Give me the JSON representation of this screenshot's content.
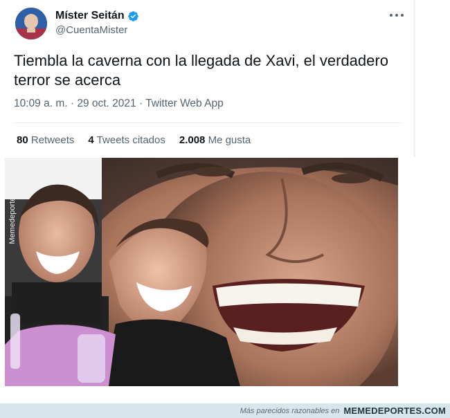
{
  "tweet": {
    "display_name": "Míster Seitán",
    "handle": "@CuentaMister",
    "text": "Tiembla la caverna con la llegada de Xavi, el verdadero terror se acerca",
    "timestamp": "10:09 a. m. · 29 oct. 2021 · Twitter Web App",
    "verified": true,
    "stats": [
      {
        "count": "80",
        "label": "Retweets"
      },
      {
        "count": "4",
        "label": "Tweets citados"
      },
      {
        "count": "2.008",
        "label": "Me gusta"
      }
    ],
    "icons": {
      "verified": "verified-badge-icon",
      "more": "more-options-icon"
    }
  },
  "media": {
    "watermark": "Memedeportes.com"
  },
  "footer": {
    "tagline": "Más parecidos razonables en",
    "brand": "MEMEDEPORTES.COM"
  },
  "colors": {
    "verified": "#1d9bf0",
    "secondary_text": "#536471",
    "footer_bg": "#d7e6ea"
  }
}
